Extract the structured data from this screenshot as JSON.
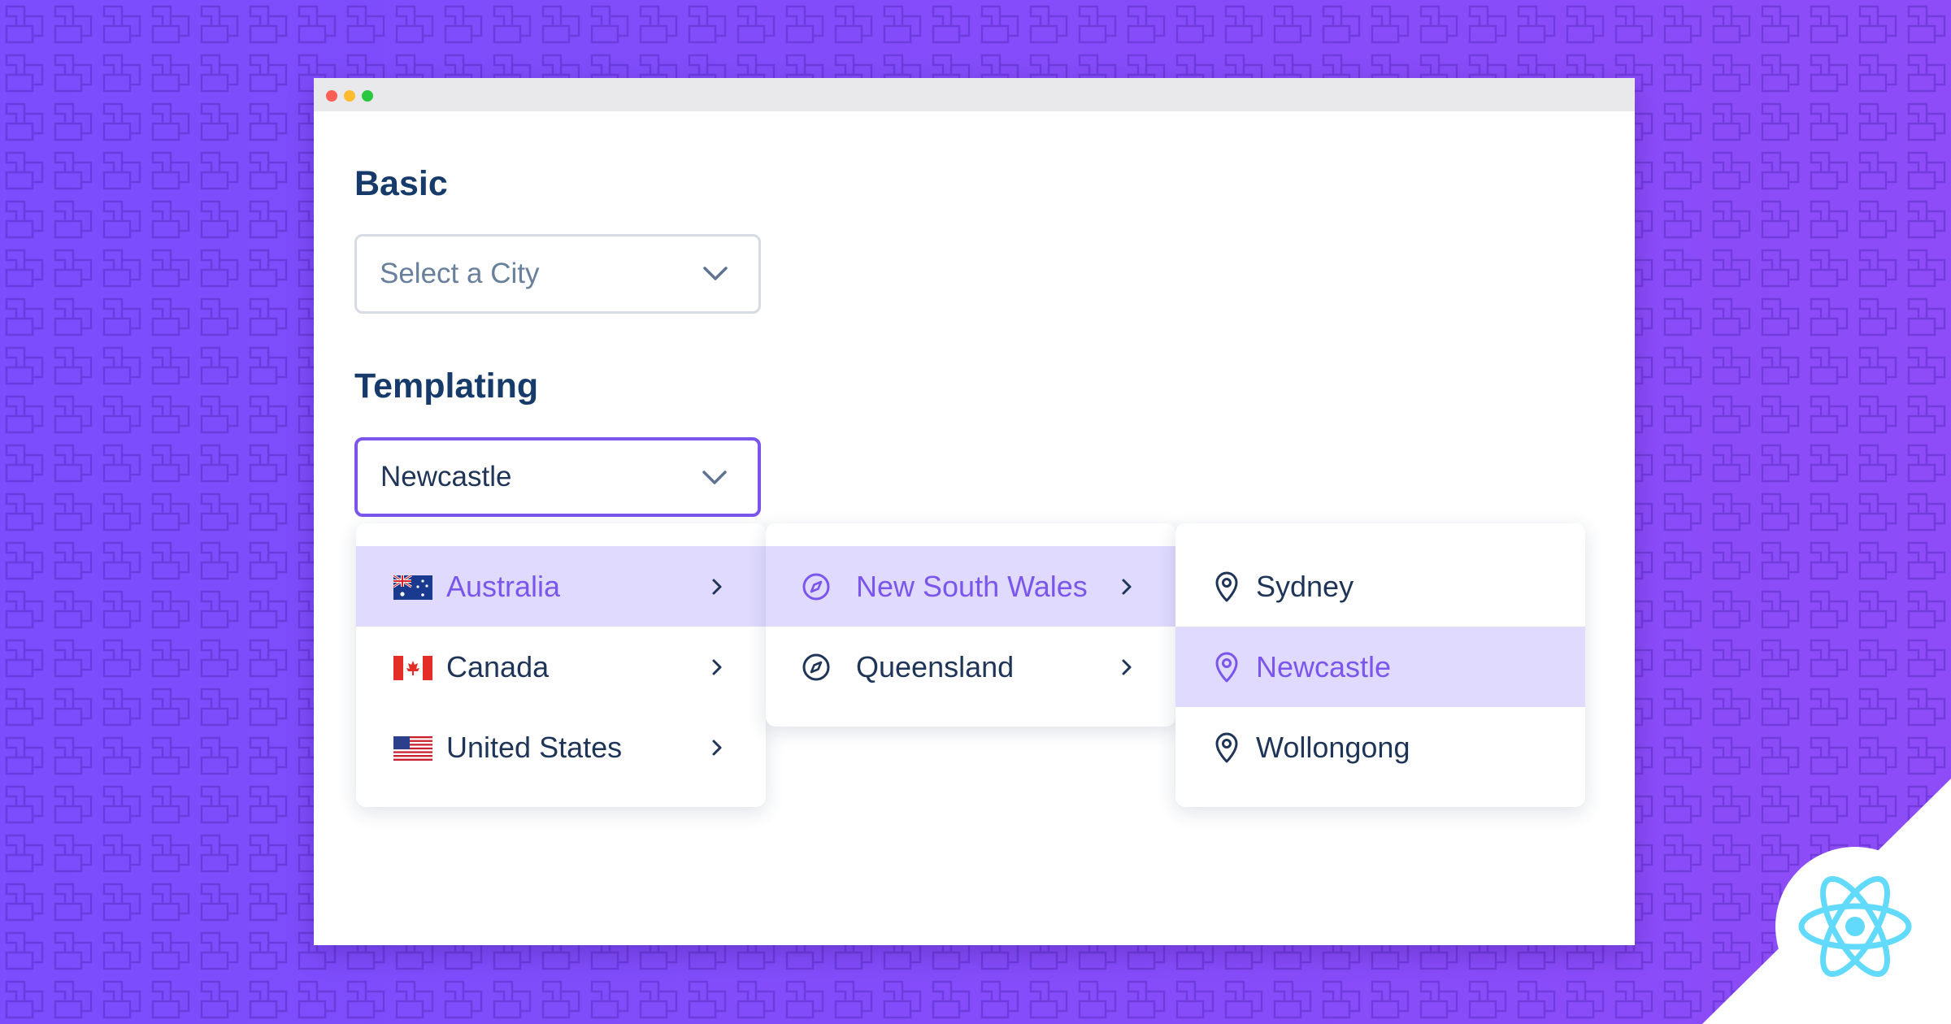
{
  "window": {
    "traffic_lights": [
      "#fd5f57",
      "#febc2e",
      "#28c840"
    ]
  },
  "basic": {
    "heading": "Basic",
    "select": {
      "placeholder": "Select a City",
      "icon": "chevron-down-icon"
    }
  },
  "templating": {
    "heading": "Templating",
    "select": {
      "value": "Newcastle",
      "icon": "chevron-down-icon"
    }
  },
  "countries": [
    {
      "label": "Australia",
      "flag": "australia-flag-icon",
      "selected": true
    },
    {
      "label": "Canada",
      "flag": "canada-flag-icon",
      "selected": false
    },
    {
      "label": "United States",
      "flag": "us-flag-icon",
      "selected": false
    }
  ],
  "states": [
    {
      "label": "New South Wales",
      "icon": "compass-icon",
      "selected": true
    },
    {
      "label": "Queensland",
      "icon": "compass-icon",
      "selected": false
    }
  ],
  "cities": [
    {
      "label": "Sydney",
      "icon": "map-pin-icon",
      "selected": false
    },
    {
      "label": "Newcastle",
      "icon": "map-pin-icon",
      "selected": true
    },
    {
      "label": "Wollongong",
      "icon": "map-pin-icon",
      "selected": false
    }
  ],
  "colors": {
    "accent": "#7a56ec",
    "selected_bg": "#e0daff",
    "heading_text": "#163b6b",
    "background_left": "#7b4dfc",
    "background_right": "#8d4cf8",
    "react_logo": "#61dafb"
  },
  "branding": {
    "logo": "react-logo-icon"
  }
}
